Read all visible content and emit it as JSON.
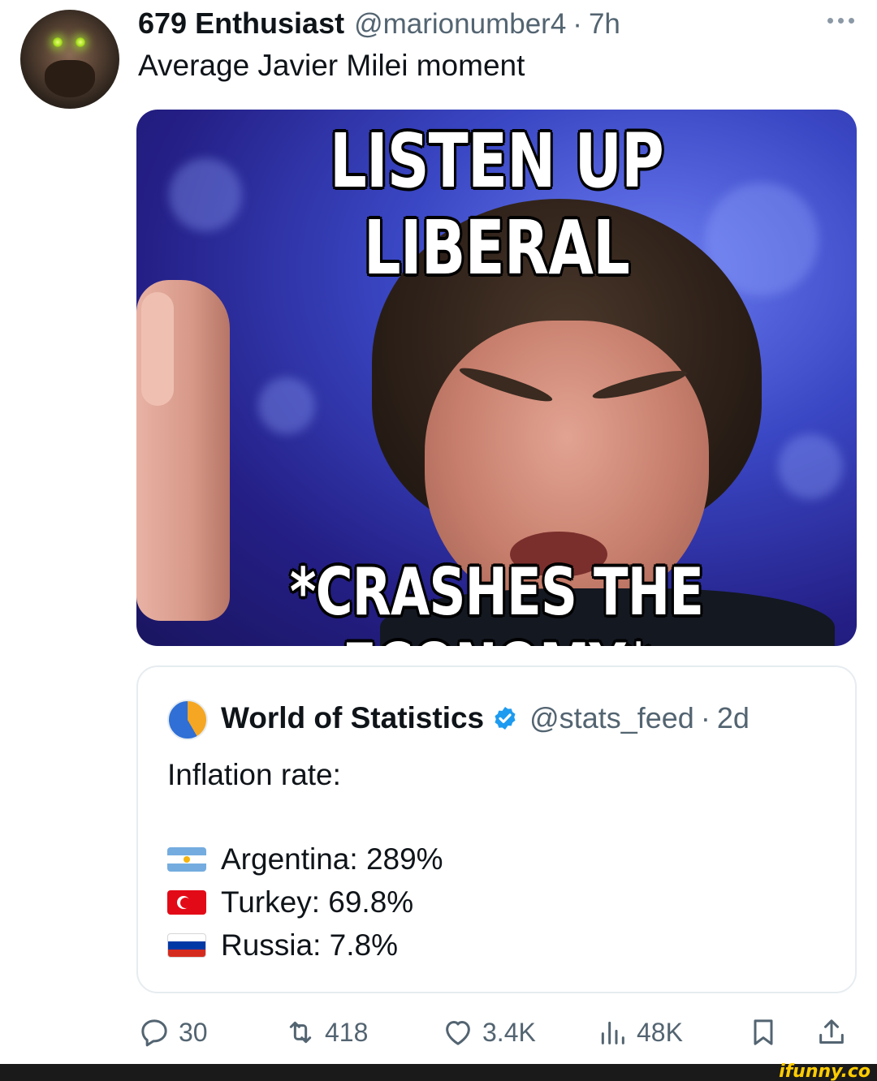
{
  "tweet": {
    "display_name": "679 Enthusiast",
    "handle": "@marionumber4",
    "separator": "·",
    "time": "7h",
    "text": "Average Javier Milei moment",
    "meme": {
      "top_text": "LISTEN UP LIBERAL",
      "bottom_text": "*CRASHES THE ECONOMY*"
    }
  },
  "quote": {
    "display_name": "World of Statistics",
    "handle": "@stats_feed",
    "separator": "·",
    "time": "2d",
    "title": "Inflation rate:",
    "stats": [
      {
        "flag_icon": "argentina-flag-icon",
        "label": "Argentina: 289%"
      },
      {
        "flag_icon": "turkey-flag-icon",
        "label": "Turkey: 69.8%"
      },
      {
        "flag_icon": "russia-flag-icon",
        "label": "Russia: 7.8%"
      }
    ]
  },
  "actions": {
    "replies": "30",
    "retweets": "418",
    "likes": "3.4K",
    "views": "48K"
  },
  "watermark": "ifunny.co",
  "colors": {
    "text_primary": "#0f1419",
    "text_secondary": "#536471",
    "verified_blue": "#1d9bf0",
    "border": "#e6ecf0"
  }
}
